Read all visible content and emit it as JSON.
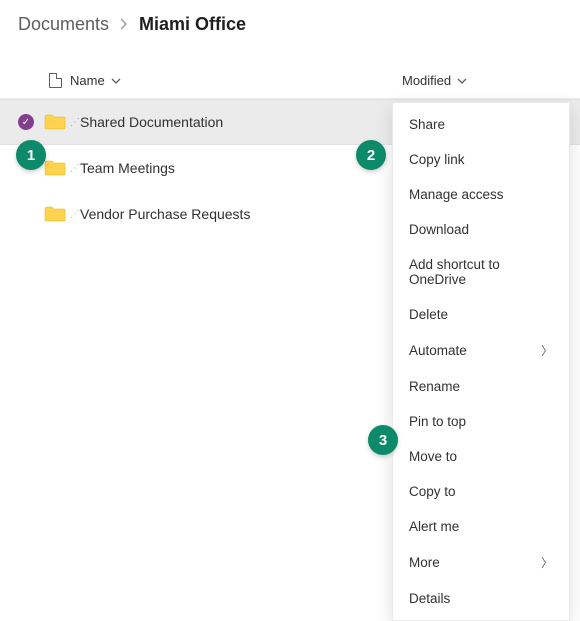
{
  "breadcrumb": {
    "root": "Documents",
    "current": "Miami Office"
  },
  "columns": {
    "name": "Name",
    "modified": "Modified"
  },
  "rows": [
    {
      "name": "Shared Documentation",
      "selected": true
    },
    {
      "name": "Team Meetings",
      "selected": false
    },
    {
      "name": "Vendor Purchase Requests",
      "selected": false
    }
  ],
  "menu": [
    {
      "label": "Share",
      "submenu": false
    },
    {
      "label": "Copy link",
      "submenu": false
    },
    {
      "label": "Manage access",
      "submenu": false
    },
    {
      "label": "Download",
      "submenu": false
    },
    {
      "label": "Add shortcut to OneDrive",
      "submenu": false
    },
    {
      "label": "Delete",
      "submenu": false
    },
    {
      "label": "Automate",
      "submenu": true
    },
    {
      "label": "Rename",
      "submenu": false
    },
    {
      "label": "Pin to top",
      "submenu": false
    },
    {
      "label": "Move to",
      "submenu": false
    },
    {
      "label": "Copy to",
      "submenu": false
    },
    {
      "label": "Alert me",
      "submenu": false
    },
    {
      "label": "More",
      "submenu": true
    },
    {
      "label": "Details",
      "submenu": false
    }
  ],
  "callouts": {
    "c1": "1",
    "c2": "2",
    "c3": "3"
  }
}
